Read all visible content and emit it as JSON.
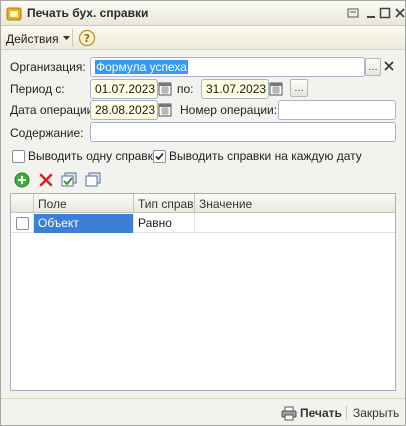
{
  "window": {
    "title": "Печать бух. справки"
  },
  "toolbar": {
    "actions_label": "Действия"
  },
  "form": {
    "organization_label": "Организация:",
    "organization_value": "Формула успеха",
    "period_label": "Период с:",
    "period_from": "01.07.2023",
    "period_to_label": "по:",
    "period_to": "31.07.2023",
    "op_date_label": "Дата операции:",
    "op_date": "28.08.2023",
    "op_number_label": "Номер операции:",
    "op_number": "",
    "content_label": "Содержание:",
    "content_value": "",
    "one_report_label": "Выводить одну справку",
    "one_report_checked": false,
    "each_date_label": "Выводить справки на каждую дату",
    "each_date_checked": true
  },
  "grid": {
    "columns": [
      "Поле",
      "Тип справ...",
      "Значение"
    ],
    "rows": [
      {
        "checked": false,
        "field": "Объект",
        "type": "Равно",
        "value": ""
      }
    ]
  },
  "footer": {
    "print_label": "Печать",
    "close_label": "Закрыть"
  }
}
